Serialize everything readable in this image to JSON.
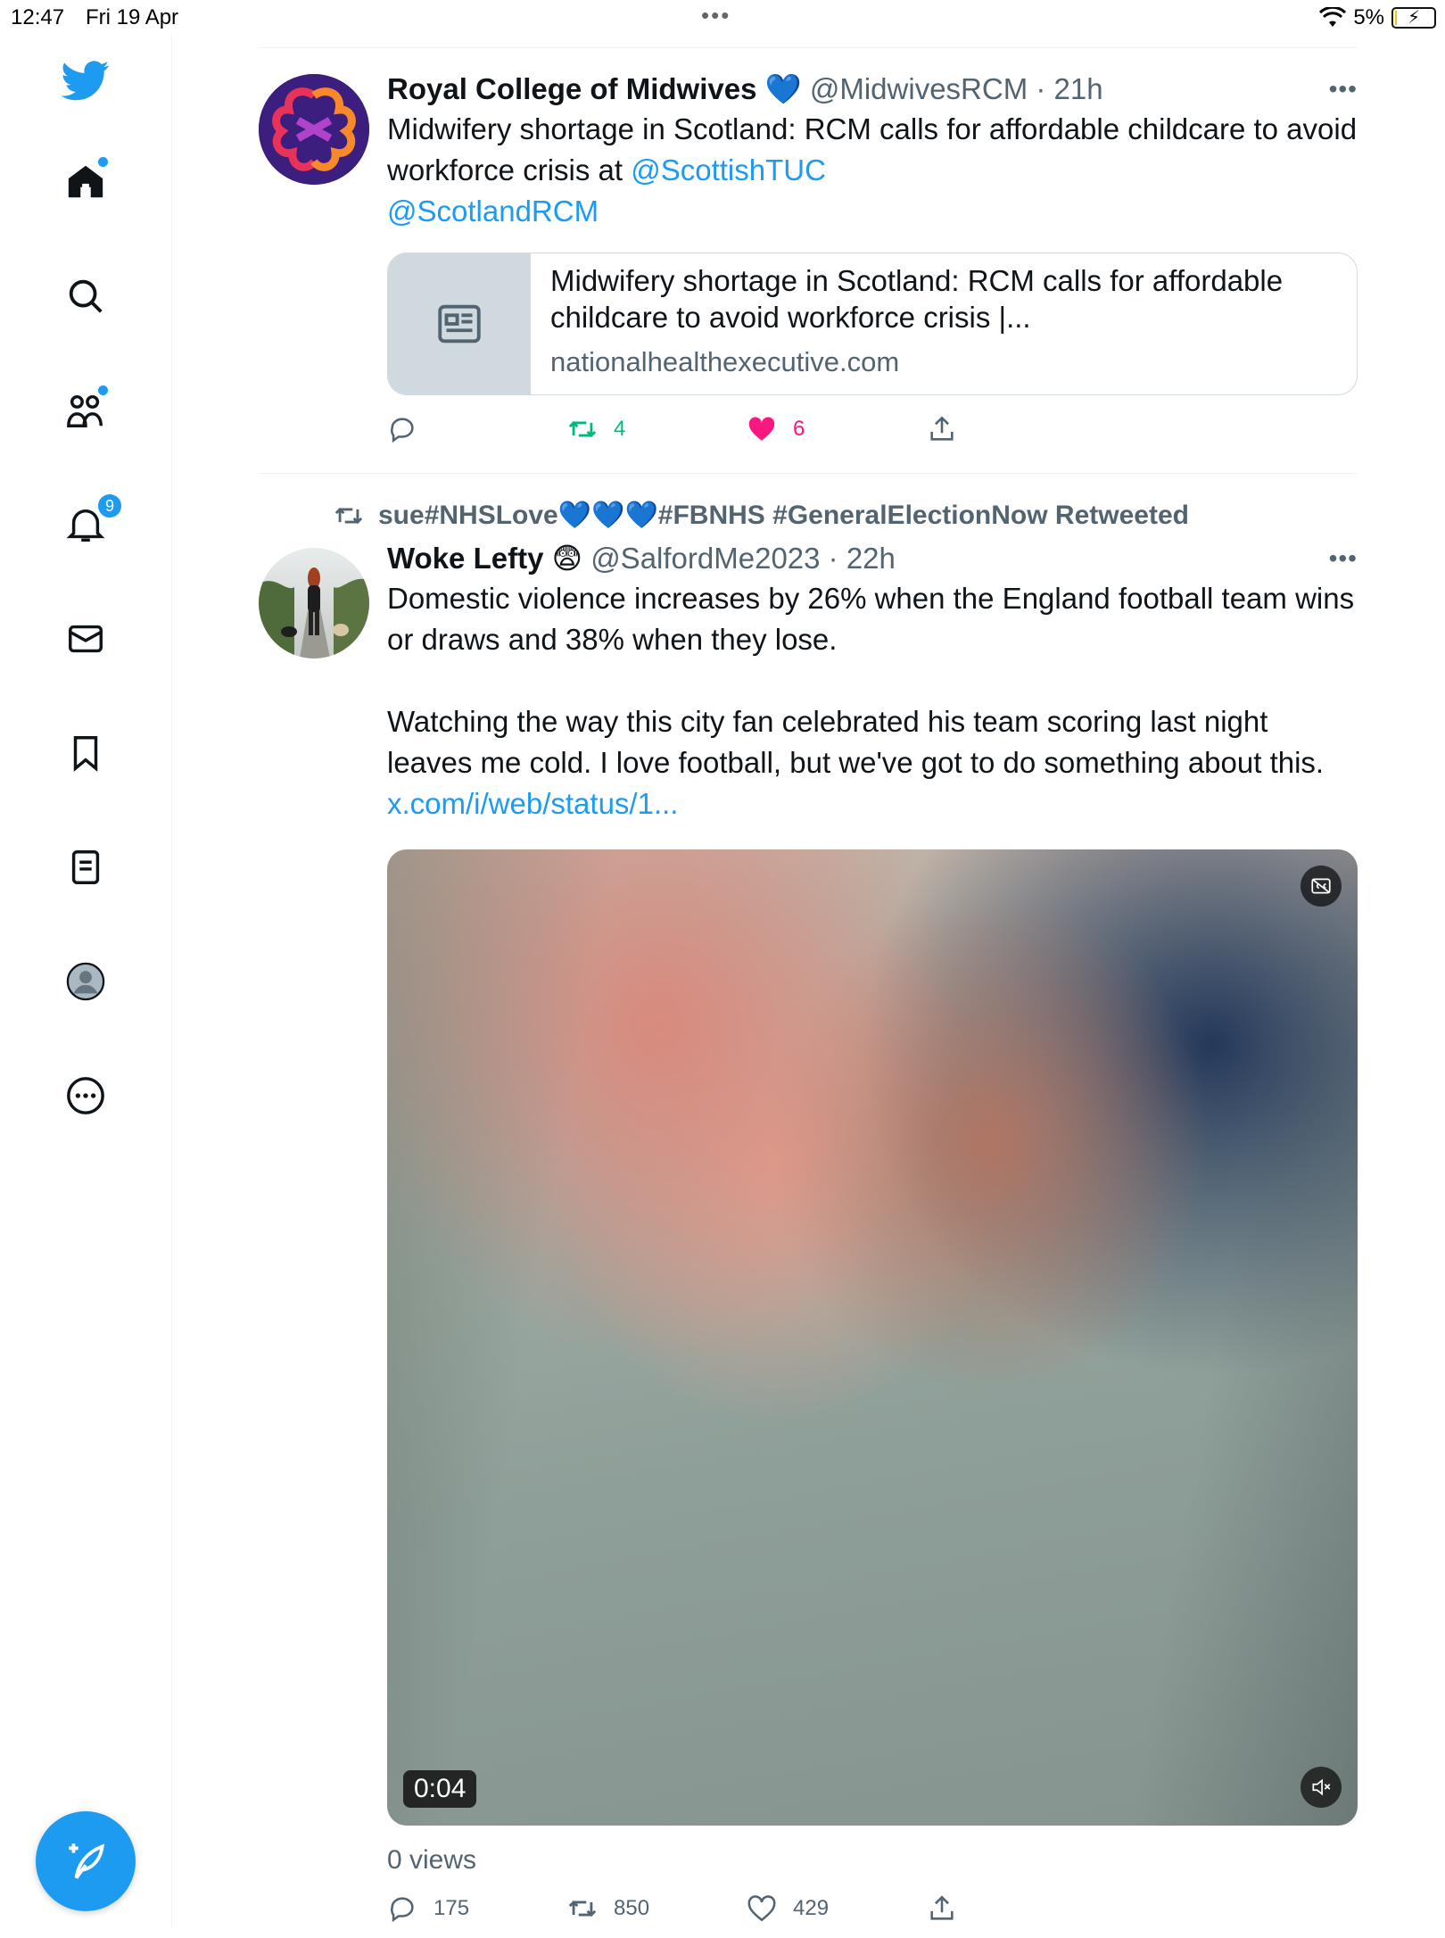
{
  "status_bar": {
    "time": "12:47",
    "date": "Fri 19 Apr",
    "dots": "•••",
    "battery_percent": "5%",
    "battery_level": 0.05
  },
  "sidebar": {
    "items": [
      {
        "name": "home",
        "icon": "home-icon",
        "has_dot": true
      },
      {
        "name": "explore",
        "icon": "search-icon"
      },
      {
        "name": "communities",
        "icon": "communities-icon",
        "has_dot": true
      },
      {
        "name": "notifications",
        "icon": "bell-icon",
        "badge": "9"
      },
      {
        "name": "messages",
        "icon": "mail-icon"
      },
      {
        "name": "bookmarks",
        "icon": "bookmark-icon"
      },
      {
        "name": "lists",
        "icon": "list-icon"
      },
      {
        "name": "profile",
        "icon": "profile-icon"
      },
      {
        "name": "more",
        "icon": "more-circle-icon"
      }
    ],
    "compose_icon": "compose-icon"
  },
  "tweets": [
    {
      "name": "Royal College of Midwives",
      "verified_emoji": "💙",
      "handle": "@MidwivesRCM · 21h",
      "text": "Midwifery shortage in Scotland: RCM calls for affordable childcare to avoid workforce crisis at ",
      "mention1": "@ScottishTUC",
      "mention2": "@ScotlandRCM",
      "card": {
        "title": "Midwifery shortage in Scotland: RCM calls for affordable childcare to avoid workforce crisis |...",
        "domain": "nationalhealthexecutive.com"
      },
      "actions": {
        "reply": "",
        "retweet": "4",
        "like": "6"
      },
      "colors": {
        "retweet": "#00ba7c",
        "like": "#f91880"
      }
    },
    {
      "retweeted_by": "sue#NHSLove💙💙💙#FBNHS #GeneralElectionNow Retweeted",
      "name": "Woke Lefty",
      "name_emoji": "😨",
      "handle": "@SalfordMe2023 · 22h",
      "text_p1": "Domestic violence increases by 26% when the England football team wins or draws and 38% when they lose.",
      "text_p2": "Watching the way this city fan celebrated his team scoring last night leaves me cold. I love football, but we've got to do something about this. ",
      "link": "x.com/i/web/status/1...",
      "video": {
        "time": "0:04"
      },
      "views": "0 views",
      "actions": {
        "reply": "175",
        "retweet": "850",
        "like": "429"
      }
    }
  ],
  "theme": {
    "accent": "#1d9bf0",
    "text_secondary": "#536471"
  }
}
